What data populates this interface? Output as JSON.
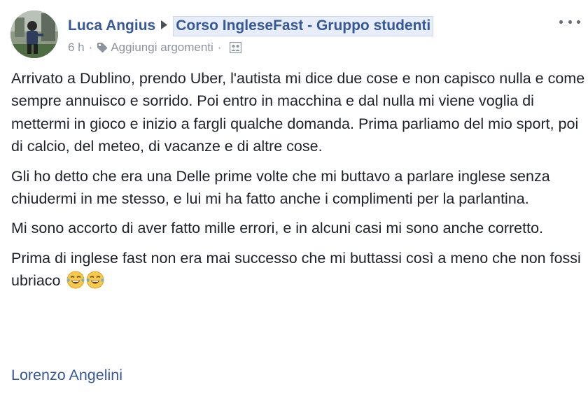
{
  "post": {
    "author": "Luca Angius",
    "group": "Corso IngleseFast - Gruppo studenti",
    "time": "6 h",
    "add_topics": "Aggiungi argomenti",
    "dot": "·",
    "paragraphs": [
      "Arrivato a Dublino, prendo Uber, l'autista mi dice due cose e non capisco nulla e come sempre annuisco e sorrido. Poi entro in macchina e dal nulla mi viene voglia di mettermi in gioco e inizio a fargli qualche domanda. Prima parliamo del mio sport, poi di calcio, del meteo, di vacanze e di altre cose.",
      "Gli ho detto che era una Delle prime volte che mi buttavo a parlare inglese senza chiudermi in me stesso, e lui mi ha fatto anche i complimenti per la parlantina.",
      "Mi sono accorto di aver fatto mille errori, e in alcuni casi mi sono anche corretto.",
      "Prima di inglese fast non era mai successo che mi buttassi così a meno che non fossi ubriaco"
    ],
    "signature": "Lorenzo Angelini",
    "icons": {
      "arrow": "right-triangle-icon",
      "tag": "tag-icon",
      "audience": "group-audience-icon",
      "more": "more-options-icon",
      "emoji": "tears-of-joy-emoji"
    },
    "colors": {
      "link": "#365899",
      "text": "#1d2129",
      "meta": "#8d949e",
      "group_highlight": "#e7eef9"
    }
  }
}
